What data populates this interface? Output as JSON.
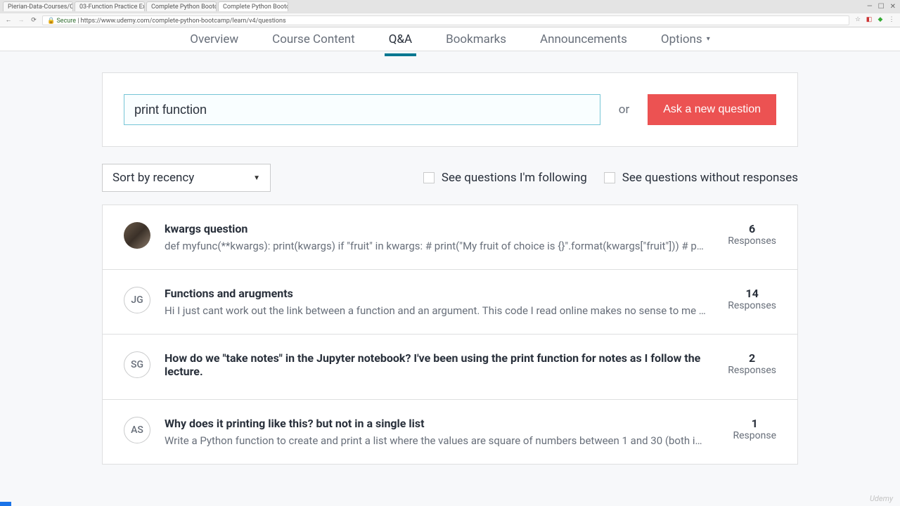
{
  "browser": {
    "tabs": [
      {
        "label": "Pierian-Data-Courses/C"
      },
      {
        "label": "03-Function Practice Ex"
      },
      {
        "label": "Complete Python Bootc"
      },
      {
        "label": "Complete Python Bootc"
      }
    ],
    "url_secure": "Secure",
    "url_proto": " | https://",
    "url_rest": "www.udemy.com/complete-python-bootcamp/learn/v4/questions",
    "window_min": "—",
    "window_max": "☐",
    "window_close": "✕"
  },
  "nav": {
    "overview": "Overview",
    "course_content": "Course Content",
    "qa": "Q&A",
    "bookmarks": "Bookmarks",
    "announcements": "Announcements",
    "options": "Options"
  },
  "search": {
    "value": "print function",
    "or": "or",
    "ask": "Ask a new question"
  },
  "filters": {
    "sort": "Sort by recency",
    "following": "See questions I'm following",
    "no_responses": "See questions without responses"
  },
  "questions": [
    {
      "avatar_type": "img",
      "initials": "",
      "title": "kwargs question",
      "snippet": "def myfunc(**kwargs):     print(kwargs)     if \"fruit\" in kwargs:         # print(\"My fruit of choice is {}\".format(kwargs[\"fruit\"]))       # pri…",
      "count": "6",
      "resp_label": "Responses"
    },
    {
      "avatar_type": "initials",
      "initials": "JG",
      "title": "Functions and arugments",
      "snippet": "Hi I just cant work out the link between a function and an argument. This code I read  online makes no sense to me at all.def h…",
      "count": "14",
      "resp_label": "Responses"
    },
    {
      "avatar_type": "initials",
      "initials": "SG",
      "title": "How do we \"take notes\" in the Jupyter notebook? I've been using the print function for notes as I follow the lecture.",
      "snippet": "",
      "count": "2",
      "resp_label": "Responses"
    },
    {
      "avatar_type": "initials",
      "initials": "AS",
      "title": "Why does it printing like this? but not in a single list",
      "snippet": "Write a Python function to create and print a list where the values are square of numbers between 1 and 30 (both included)?[im…",
      "count": "1",
      "resp_label": "Response"
    }
  ],
  "watermark": "Udemy"
}
